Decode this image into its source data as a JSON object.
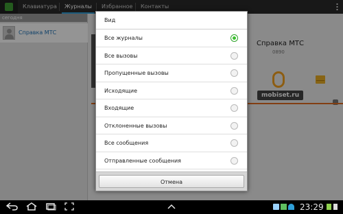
{
  "tabs": [
    {
      "label": "Клавиатура"
    },
    {
      "label": "Журналы"
    },
    {
      "label": "Избранное"
    },
    {
      "label": "Контакты"
    }
  ],
  "leftpane": {
    "section_header": "сегодня",
    "contact_name": "Справка МТС"
  },
  "detail": {
    "name": "Справка МТС",
    "number": "0890"
  },
  "watermark": "mobiset.ru",
  "dialog": {
    "title": "Вид",
    "options": [
      {
        "label": "Все журналы",
        "checked": true
      },
      {
        "label": "Все вызовы",
        "checked": false
      },
      {
        "label": "Пропущенные вызовы",
        "checked": false
      },
      {
        "label": "Исходящие",
        "checked": false
      },
      {
        "label": "Входящие",
        "checked": false
      },
      {
        "label": "Отклоненные вызовы",
        "checked": false
      },
      {
        "label": "Все сообщения",
        "checked": false
      },
      {
        "label": "Отправленные сообщения",
        "checked": false
      }
    ],
    "cancel_label": "Отмена"
  },
  "system_bar": {
    "nav_icons": [
      "back-icon",
      "home-icon",
      "recent-apps-icon",
      "screenshot-icon",
      "menu-up-icon"
    ],
    "status_icons": [
      "usb-icon",
      "download-icon",
      "wifi-icon",
      "signal-icon"
    ],
    "clock": "23:29"
  },
  "colors": {
    "accent_blue": "#2f9fd8",
    "radio_green": "#3bbf2f",
    "brand_orange": "#e06b1f"
  }
}
